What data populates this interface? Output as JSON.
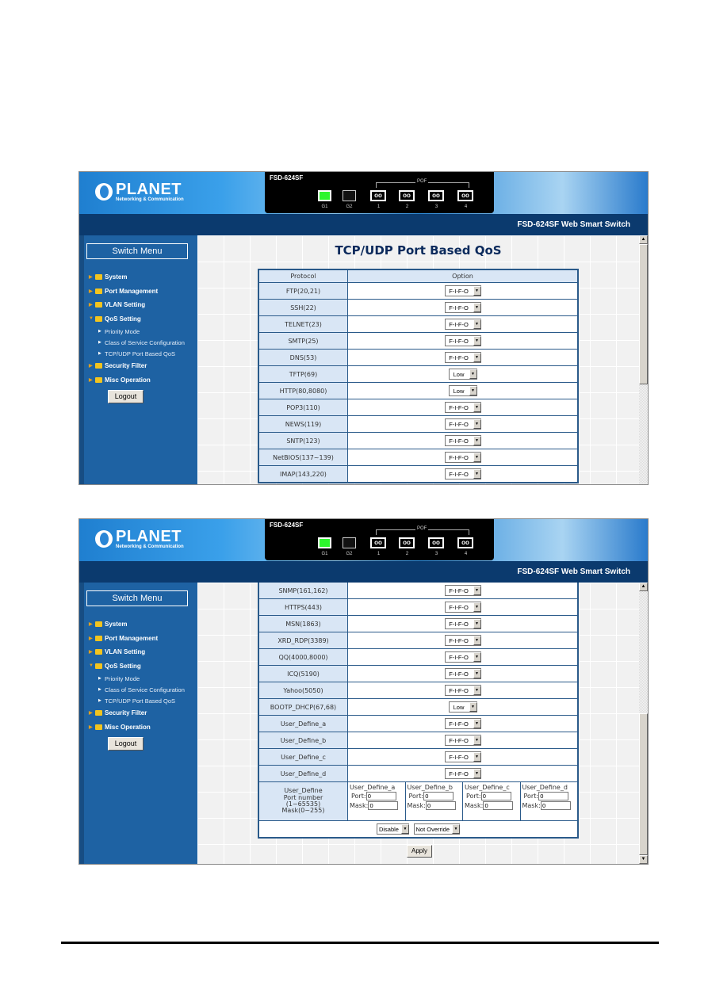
{
  "app": {
    "logo": "PLANET",
    "logo_tagline": "Networking & Communication",
    "device_model": "FSD-624SF",
    "product_title": "FSD-624SF Web Smart Switch",
    "pof_label": "POF",
    "ports": [
      {
        "label": "G1",
        "type": "rj45",
        "status": "link-up"
      },
      {
        "label": "G2",
        "type": "rj45",
        "status": "down"
      },
      {
        "label": "1",
        "type": "fiber"
      },
      {
        "label": "2",
        "type": "fiber"
      },
      {
        "label": "3",
        "type": "fiber"
      },
      {
        "label": "4",
        "type": "fiber"
      }
    ]
  },
  "sidebar": {
    "title": "Switch Menu",
    "items": [
      {
        "label": "System",
        "expanded": false
      },
      {
        "label": "Port Management",
        "expanded": false
      },
      {
        "label": "VLAN Setting",
        "expanded": false
      },
      {
        "label": "QoS Setting",
        "expanded": true,
        "children": [
          "Priority Mode",
          "Class of Service Configuration",
          "TCP/UDP Port Based QoS"
        ]
      },
      {
        "label": "Security Filter",
        "expanded": false
      },
      {
        "label": "Misc Operation",
        "expanded": false
      }
    ],
    "logout_label": "Logout"
  },
  "page": {
    "title": "TCP/UDP Port Based QoS",
    "col_protocol": "Protocol",
    "col_option": "Option"
  },
  "screen1_rows": [
    {
      "protocol": "FTP(20,21)",
      "option": "F-I-F-O"
    },
    {
      "protocol": "SSH(22)",
      "option": "F-I-F-O"
    },
    {
      "protocol": "TELNET(23)",
      "option": "F-I-F-O"
    },
    {
      "protocol": "SMTP(25)",
      "option": "F-I-F-O"
    },
    {
      "protocol": "DNS(53)",
      "option": "F-I-F-O"
    },
    {
      "protocol": "TFTP(69)",
      "option": "Low"
    },
    {
      "protocol": "HTTP(80,8080)",
      "option": "Low"
    },
    {
      "protocol": "POP3(110)",
      "option": "F-I-F-O"
    },
    {
      "protocol": "NEWS(119)",
      "option": "F-I-F-O"
    },
    {
      "protocol": "SNTP(123)",
      "option": "F-I-F-O"
    },
    {
      "protocol": "NetBIOS(137~139)",
      "option": "F-I-F-O"
    },
    {
      "protocol": "IMAP(143,220)",
      "option": "F-I-F-O"
    }
  ],
  "screen2_rows": [
    {
      "protocol": "SNMP(161,162)",
      "option": "F-I-F-O"
    },
    {
      "protocol": "HTTPS(443)",
      "option": "F-I-F-O"
    },
    {
      "protocol": "MSN(1863)",
      "option": "F-I-F-O"
    },
    {
      "protocol": "XRD_RDP(3389)",
      "option": "F-I-F-O"
    },
    {
      "protocol": "QQ(4000,8000)",
      "option": "F-I-F-O"
    },
    {
      "protocol": "ICQ(5190)",
      "option": "F-I-F-O"
    },
    {
      "protocol": "Yahoo(5050)",
      "option": "F-I-F-O"
    },
    {
      "protocol": "BOOTP_DHCP(67,68)",
      "option": "Low"
    },
    {
      "protocol": "User_Define_a",
      "option": "F-I-F-O"
    },
    {
      "protocol": "User_Define_b",
      "option": "F-I-F-O"
    },
    {
      "protocol": "User_Define_c",
      "option": "F-I-F-O"
    },
    {
      "protocol": "User_Define_d",
      "option": "F-I-F-O"
    }
  ],
  "user_define": {
    "label_line1": "User_Define",
    "label_line2": "Port number",
    "label_line3": "(1~65535)",
    "label_line4": "Mask(0~255)",
    "port_label": "Port:",
    "mask_label": "Mask:",
    "entries": [
      {
        "name": "User_Define_a",
        "port": "0",
        "mask": "0"
      },
      {
        "name": "User_Define_b",
        "port": "0",
        "mask": "0"
      },
      {
        "name": "User_Define_c",
        "port": "0",
        "mask": "0"
      },
      {
        "name": "User_Define_d",
        "port": "0",
        "mask": "0"
      }
    ]
  },
  "bottom_controls": {
    "mode_select": "Disable",
    "override_select": "Not Override",
    "apply_label": "Apply"
  }
}
